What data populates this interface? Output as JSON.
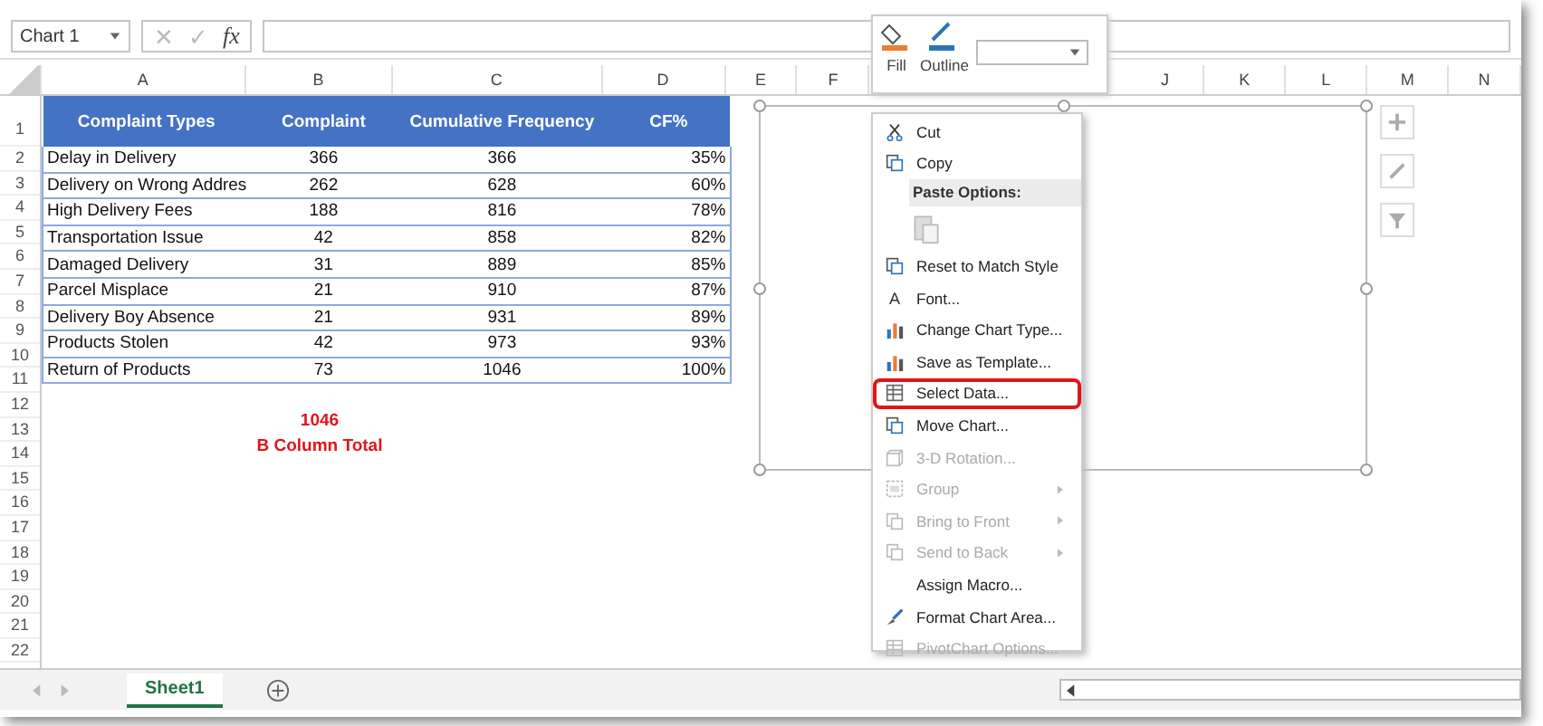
{
  "formula_bar": {
    "name_box": "Chart 1",
    "cancel": "✕",
    "enter": "✓",
    "function": "fx"
  },
  "column_headers": [
    "A",
    "B",
    "C",
    "D",
    "E",
    "F",
    "J",
    "K",
    "L",
    "M",
    "N"
  ],
  "table": {
    "columns": [
      "Complaint Types",
      "Complaint",
      "Cumulative Frequency",
      "CF%"
    ],
    "rows": [
      [
        "Delay in Delivery",
        "366",
        "366",
        "35%"
      ],
      [
        "Delivery on Wrong Addres",
        "262",
        "628",
        "60%"
      ],
      [
        "High Delivery Fees",
        "188",
        "816",
        "78%"
      ],
      [
        "Transportation Issue",
        "42",
        "858",
        "82%"
      ],
      [
        "Damaged Delivery",
        "31",
        "889",
        "85%"
      ],
      [
        "Parcel Misplace",
        "21",
        "910",
        "87%"
      ],
      [
        "Delivery Boy Absence",
        "21",
        "931",
        "89%"
      ],
      [
        "Products Stolen",
        "42",
        "973",
        "93%"
      ],
      [
        "Return of Products",
        "73",
        "1046",
        "100%"
      ]
    ]
  },
  "row_numbers": [
    "1",
    "2",
    "3",
    "4",
    "5",
    "6",
    "7",
    "8",
    "9",
    "10",
    "11",
    "12",
    "13",
    "14",
    "15",
    "16",
    "17",
    "18",
    "19",
    "20",
    "21",
    "22"
  ],
  "total": {
    "value": "1046",
    "label": "B Column Total"
  },
  "mini_toolbar": {
    "fill": "Fill",
    "outline": "Outline"
  },
  "context_menu": [
    {
      "kind": "item",
      "label": "Cut",
      "disabled": false,
      "submenu": false,
      "highlighted": false
    },
    {
      "kind": "item",
      "label": "Copy",
      "disabled": false,
      "submenu": false,
      "highlighted": false
    },
    {
      "kind": "header",
      "label": "Paste Options:"
    },
    {
      "kind": "paste"
    },
    {
      "kind": "item",
      "label": "Reset to Match Style",
      "disabled": false,
      "submenu": false,
      "highlighted": false
    },
    {
      "kind": "item",
      "label": "Font...",
      "icon_text": "A",
      "disabled": false,
      "submenu": false,
      "highlighted": false
    },
    {
      "kind": "item",
      "label": "Change Chart Type...",
      "disabled": false,
      "submenu": false,
      "highlighted": false
    },
    {
      "kind": "item",
      "label": "Save as Template...",
      "disabled": false,
      "submenu": false,
      "highlighted": false
    },
    {
      "kind": "item",
      "label": "Select Data...",
      "disabled": false,
      "submenu": false,
      "highlighted": true
    },
    {
      "kind": "item",
      "label": "Move Chart...",
      "disabled": false,
      "submenu": false,
      "highlighted": false
    },
    {
      "kind": "item",
      "label": "3-D Rotation...",
      "disabled": true,
      "submenu": false,
      "highlighted": false
    },
    {
      "kind": "item",
      "label": "Group",
      "disabled": true,
      "submenu": true,
      "highlighted": false
    },
    {
      "kind": "item",
      "label": "Bring to Front",
      "disabled": true,
      "submenu": true,
      "highlighted": false
    },
    {
      "kind": "item",
      "label": "Send to Back",
      "disabled": true,
      "submenu": true,
      "highlighted": false
    },
    {
      "kind": "item",
      "label": "Assign Macro...",
      "disabled": false,
      "submenu": false,
      "highlighted": false
    },
    {
      "kind": "item",
      "label": "Format Chart Area...",
      "disabled": false,
      "submenu": false,
      "highlighted": false
    },
    {
      "kind": "item",
      "label": "PivotChart Options...",
      "disabled": true,
      "submenu": false,
      "highlighted": false
    }
  ],
  "sheet_tabs": [
    {
      "label": "Sheet1",
      "selected": true
    }
  ]
}
